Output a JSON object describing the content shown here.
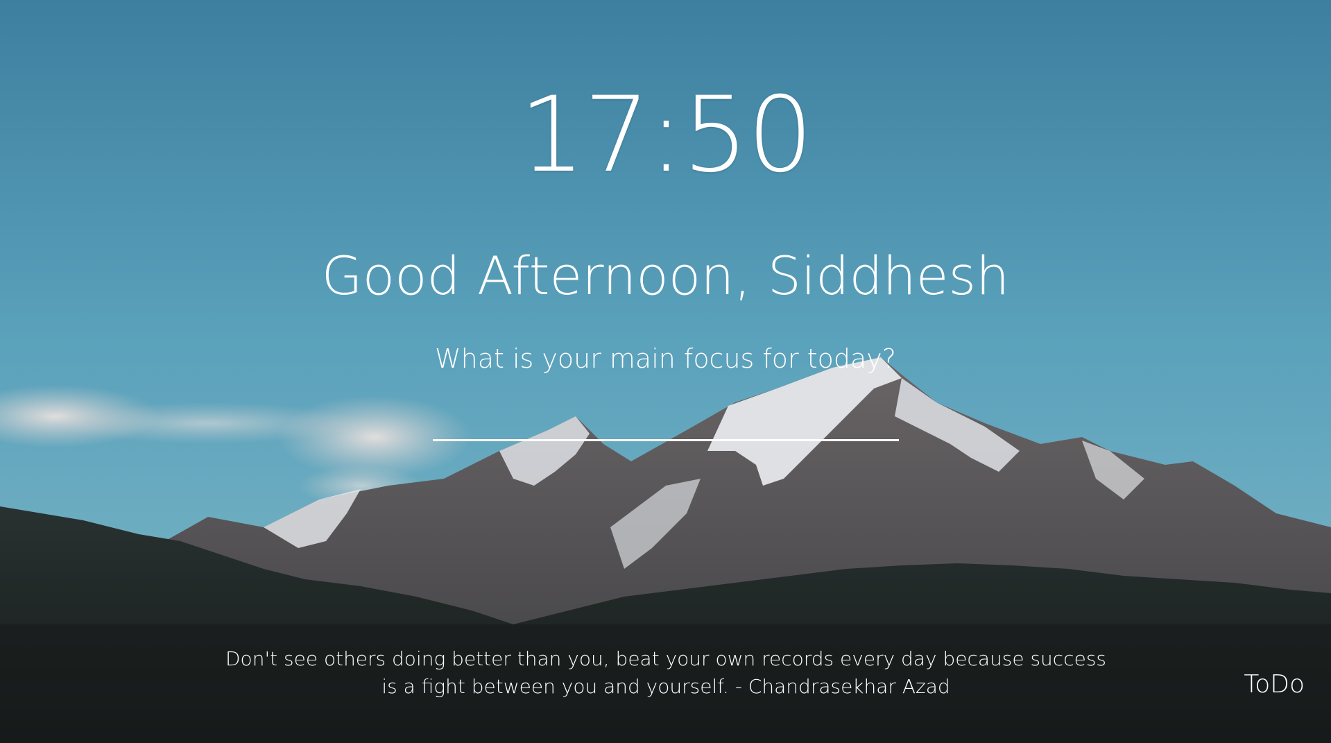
{
  "clock": {
    "time": "17:50"
  },
  "greeting": {
    "text": "Good Afternoon, Siddhesh"
  },
  "focus": {
    "question": "What is your main focus for today?",
    "input_value": "",
    "input_placeholder": ""
  },
  "quote": {
    "line1": "Don't see others doing better than you, beat your own records every day because success",
    "line2": "is a fight between you and yourself. - Chandrasekhar Azad"
  },
  "todo": {
    "label": "ToDo"
  },
  "colors": {
    "sky_top": "#3f88a6",
    "sky_mid": "#5aa3bd",
    "mountain_rock": "#5d5a5c",
    "snow": "#e8eaec",
    "forest": "#1f2422",
    "text": "#ffffff"
  },
  "background": {
    "scene": "snow-capped-mountain-landscape"
  }
}
